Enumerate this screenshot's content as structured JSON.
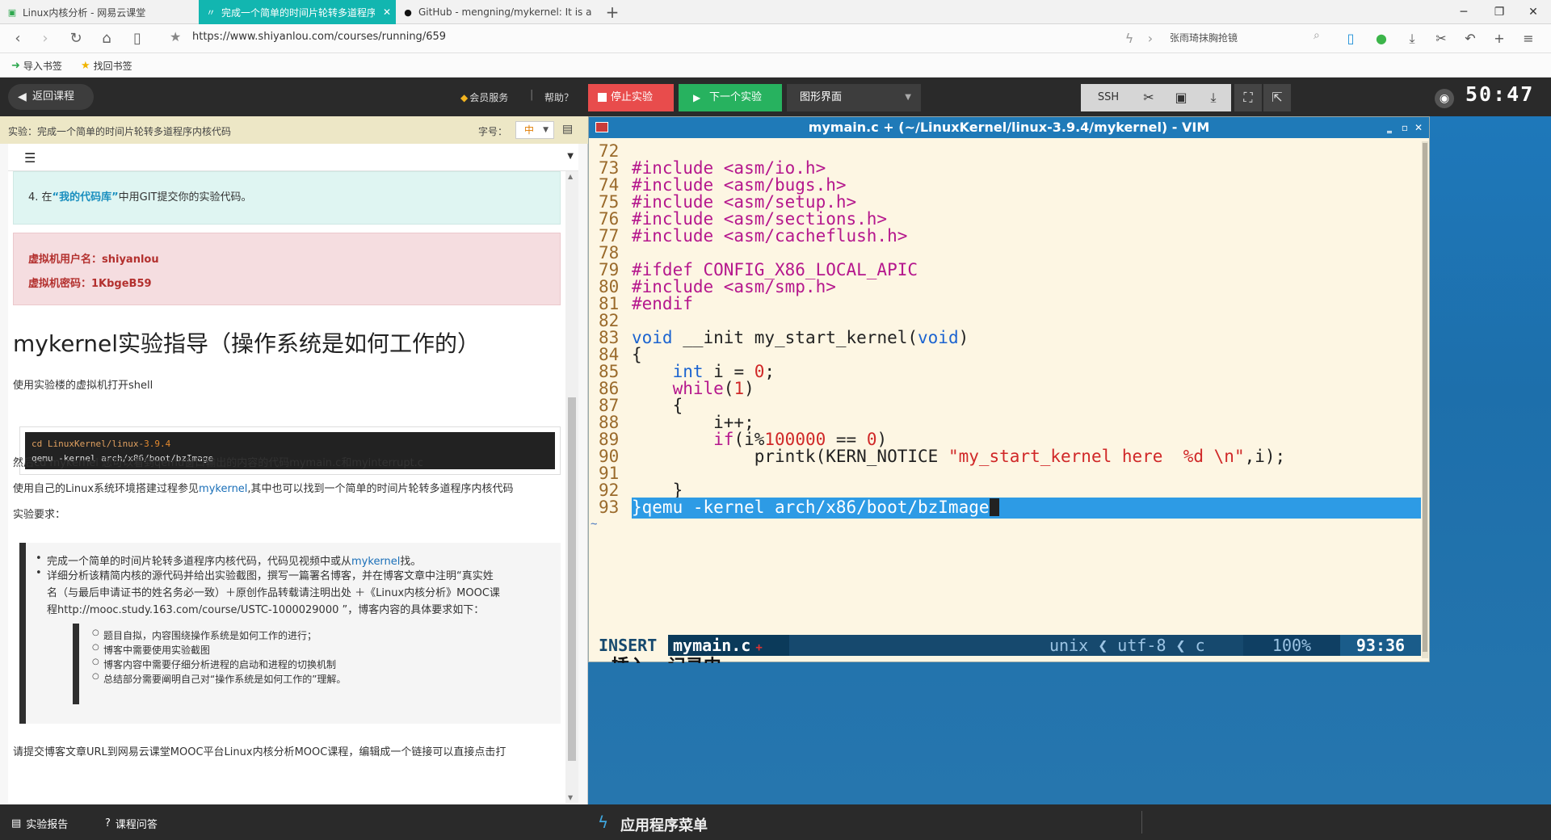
{
  "browser": {
    "tabs": [
      {
        "title": "Linux内核分析 - 网易云课堂",
        "active": false
      },
      {
        "title": "完成一个简单的时间片轮转多道程序内核代码",
        "active": true
      },
      {
        "title": "GitHub - mengning/mykernel: It is a",
        "active": false
      }
    ],
    "url": "https://www.shiyanlou.com/courses/running/659",
    "search_text": "张雨琦抹胸抢镜",
    "bookmarks": [
      "导入书签",
      "找回书签"
    ]
  },
  "toolbar": {
    "back_label": "返回课程",
    "vip_label": "会员服务",
    "separator": "|",
    "help_label": "帮助？",
    "stop_label": "停止实验",
    "next_label": "下一个实验",
    "gui_label": "图形界面",
    "ssh_label": "SSH",
    "timer": "50:47"
  },
  "left": {
    "header_title": "实验：完成一个简单的时间片轮转多道程序内核代码",
    "fontsize_label": "字号：",
    "fontsize_value": "中",
    "info_prefix": "4. 在",
    "info_link": "“我的代码库”",
    "info_suffix": "中用GIT提交你的实验代码。",
    "vm_user": "虚拟机用户名：shiyanlou",
    "vm_pass": "虚拟机密码：1KbgeB59",
    "heading": "mykernel实验指导（操作系统是如何工作的）",
    "p1": "使用实验楼的虚拟机打开shell",
    "code_line1_a": "cd LinuxKernel/linux-",
    "code_line1_b": "3.9.4",
    "code_line2": "qemu -kernel arch/x86/boot/bzImage",
    "p2": "然后cd mykernel 您可以看到qemu窗口输出的内容的代码mymain.c和myinterrupt.c",
    "p3_a": "使用自己的Linux系统环境搭建过程参见",
    "p3_link": "mykernel",
    "p3_b": ",其中也可以找到一个简单的时间片轮转多道程序内核代码",
    "p4": "实验要求：",
    "req1_a": "完成一个简单的时间片轮转多道程序内核代码，代码见视频中或从",
    "req1_link": "mykernel",
    "req1_b": "找。",
    "req2_l1": "详细分析该精简内核的源代码并给出实验截图，撰写一篇署名博客，并在博客文章中注明“真实姓",
    "req2_l2": "名（与最后申请证书的姓名务必一致）＋原创作品转载请注明出处 ＋《Linux内核分析》MOOC课",
    "req2_l3": "程http://mooc.study.163.com/course/USTC-1000029000 ”，博客内容的具体要求如下：",
    "sub": [
      "题目自拟，内容围绕操作系统是如何工作的进行；",
      "博客中需要使用实验截图",
      "博客内容中需要仔细分析进程的启动和进程的切换机制",
      "总结部分需要阐明自己对“操作系统是如何工作的”理解。"
    ],
    "p5": "请提交博客文章URL到网易云课堂MOOC平台Linux内核分析MOOC课程，编辑成一个链接可以直接点击打",
    "bottom": [
      "实验报告",
      "课程问答"
    ]
  },
  "vim": {
    "title": "mymain.c + (~/LinuxKernel/linux-3.9.4/mykernel) - VIM",
    "lines": [
      {
        "n": "72",
        "t": ""
      },
      {
        "n": "73",
        "t": "#include <asm/io.h>"
      },
      {
        "n": "74",
        "t": "#include <asm/bugs.h>"
      },
      {
        "n": "75",
        "t": "#include <asm/setup.h>"
      },
      {
        "n": "76",
        "t": "#include <asm/sections.h>"
      },
      {
        "n": "77",
        "t": "#include <asm/cacheflush.h>"
      },
      {
        "n": "78",
        "t": ""
      },
      {
        "n": "79",
        "t": "#ifdef CONFIG_X86_LOCAL_APIC"
      },
      {
        "n": "80",
        "t": "#include <asm/smp.h>"
      },
      {
        "n": "81",
        "t": "#endif"
      },
      {
        "n": "82",
        "t": ""
      },
      {
        "n": "83",
        "t": "void __init my_start_kernel(void)"
      },
      {
        "n": "84",
        "t": "{"
      },
      {
        "n": "85",
        "t": "    int i = 0;"
      },
      {
        "n": "86",
        "t": "    while(1)"
      },
      {
        "n": "87",
        "t": "    {"
      },
      {
        "n": "88",
        "t": "        i++;"
      },
      {
        "n": "89",
        "t": "        if(i%100000 == 0)"
      },
      {
        "n": "90",
        "t": "            printk(KERN_NOTICE \"my_start_kernel here  %d \\n\",i);"
      },
      {
        "n": "91",
        "t": ""
      },
      {
        "n": "92",
        "t": "    }"
      },
      {
        "n": "93",
        "t": "}qemu -kernel arch/x86/boot/bzImage"
      }
    ],
    "status_mode": "INSERT",
    "status_file": "mymain.c",
    "status_mod": "+",
    "status_enc": "unix ❮ utf-8 ❮ c",
    "status_pct": "100%",
    "status_pos": "93:36",
    "cmdline": "-- 插入 --记录中"
  },
  "taskbar": {
    "menu_label": "应用程序菜单"
  }
}
